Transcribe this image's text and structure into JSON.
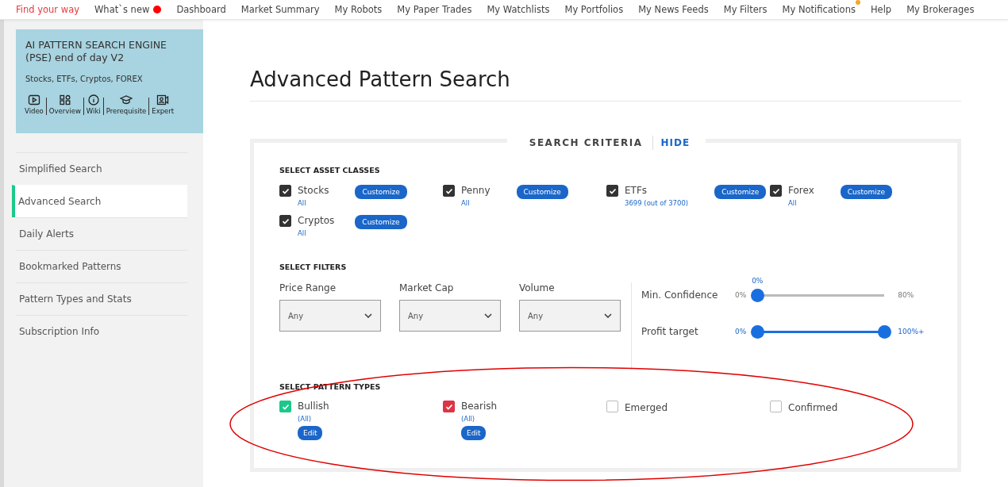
{
  "nav": [
    {
      "label": "Find your way",
      "kind": "accent"
    },
    {
      "label": "What`s new",
      "kind": "plain",
      "color": "#ff0000"
    },
    {
      "label": "Dashboard",
      "kind": "plain"
    },
    {
      "label": "Market Summary",
      "kind": "plain"
    },
    {
      "label": "My Robots",
      "kind": "plain"
    },
    {
      "label": "My Paper Trades",
      "kind": "plain"
    },
    {
      "label": "My Watchlists",
      "kind": "plain"
    },
    {
      "label": "My Portfolios",
      "kind": "plain"
    },
    {
      "label": "My News Feeds",
      "kind": "plain"
    },
    {
      "label": "My Filters",
      "kind": "plain"
    },
    {
      "label": "My Notifications",
      "kind": "plain",
      "color": "#f5a623"
    },
    {
      "label": "Help",
      "kind": "plain"
    },
    {
      "label": "My Brokerages",
      "kind": "plain"
    }
  ],
  "product": {
    "title": "AI PATTERN SEARCH ENGINE (PSE) end of day V2",
    "subtitle": "Stocks, ETFs, Cryptos, FOREX",
    "links": [
      {
        "label": "Video",
        "kind": "video"
      },
      {
        "label": "Overview",
        "kind": "overview"
      },
      {
        "label": "Wiki",
        "kind": "info"
      },
      {
        "label": "Prerequisite",
        "kind": "cap"
      },
      {
        "label": "Expert",
        "kind": "expert"
      }
    ]
  },
  "sidebar": {
    "items": [
      {
        "label": "Simplified Search",
        "selected": false
      },
      {
        "label": "Advanced Search",
        "selected": true
      },
      {
        "label": "Daily Alerts",
        "selected": false
      },
      {
        "label": "Bookmarked Patterns",
        "selected": false
      },
      {
        "label": "Pattern Types and Stats",
        "selected": false
      },
      {
        "label": "Subscription Info",
        "selected": false
      }
    ]
  },
  "page_title": "Advanced Pattern Search",
  "criteria": {
    "title": "SEARCH CRITERIA",
    "toggle": "HIDE",
    "asset_heading": "SELECT ASSET CLASSES",
    "assets": [
      {
        "label": "Stocks",
        "checked": true,
        "count": "All",
        "button": "Customize"
      },
      {
        "label": "Penny",
        "checked": true,
        "count": "All",
        "button": "Customize"
      },
      {
        "label": "ETFs",
        "checked": true,
        "count": "3699 (out of 3700)",
        "button": "Customize"
      },
      {
        "label": "Forex",
        "checked": true,
        "count": "All",
        "button": "Customize"
      },
      {
        "label": "Cryptos",
        "checked": true,
        "count": "All",
        "button": "Customize"
      }
    ],
    "filter_heading": "SELECT FILTERS",
    "dropdowns": [
      {
        "label": "Price Range",
        "value": "Any"
      },
      {
        "label": "Market Cap",
        "value": "Any"
      },
      {
        "label": "Volume",
        "value": "Any"
      }
    ],
    "sliders": [
      {
        "label": "Min. Confidence",
        "min": "0%",
        "max": "80%",
        "reading": "0%",
        "level": 0,
        "kind": "single"
      },
      {
        "label": "Profit target",
        "min": "0%",
        "max": "100%+",
        "level": 1,
        "kind": "range"
      }
    ],
    "pattern_heading": "SELECT PATTERN TYPES",
    "patterns": [
      {
        "label": "Bullish",
        "checked": true,
        "color": "#1cc88a",
        "sub": "(All)",
        "button": "Edit"
      },
      {
        "label": "Bearish",
        "checked": true,
        "color": "#dc3545",
        "sub": "(All)",
        "button": "Edit"
      },
      {
        "label": "Emerged",
        "checked": false
      },
      {
        "label": "Confirmed",
        "checked": false
      }
    ]
  },
  "highlighted": true
}
